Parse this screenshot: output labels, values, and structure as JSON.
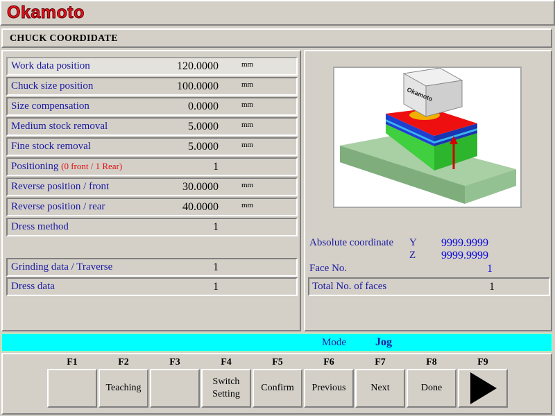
{
  "brand": "Okamoto",
  "screen_title": "CHUCK COORDIDATE",
  "params": [
    {
      "label": "Work data position",
      "value": "120.0000",
      "unit": "mm"
    },
    {
      "label": "Chuck size position",
      "value": "100.0000",
      "unit": "mm"
    },
    {
      "label": "Size compensation",
      "value": "0.0000",
      "unit": "mm"
    },
    {
      "label": "Medium stock removal",
      "value": "5.0000",
      "unit": "mm"
    },
    {
      "label": "Fine stock removal",
      "value": "5.0000",
      "unit": "mm"
    },
    {
      "label": "Positioning",
      "note": "(0 front / 1 Rear)",
      "value": "1",
      "unit": ""
    },
    {
      "label": "Reverse position / front",
      "value": "30.0000",
      "unit": "mm"
    },
    {
      "label": "Reverse position / rear",
      "value": "40.0000",
      "unit": "mm"
    },
    {
      "label": "Dress method",
      "value": "1",
      "unit": ""
    }
  ],
  "extra_params": [
    {
      "label": "Grinding data / Traverse",
      "value": "1"
    },
    {
      "label": "Dress data",
      "value": "1"
    }
  ],
  "illustration": {
    "wheel_text": "Okamoto"
  },
  "status": {
    "abs_coord_label": "Absolute coordinate",
    "y_axis": "Y",
    "y_value": "9999.9999",
    "z_axis": "Z",
    "z_value": "9999.9999",
    "face_no_label": "Face No.",
    "face_no_value": "1",
    "total_faces_label": "Total No. of faces",
    "total_faces_value": "1"
  },
  "mode": {
    "label": "Mode",
    "value": "Jog"
  },
  "function_keys": [
    {
      "key": "F1",
      "label": ""
    },
    {
      "key": "F2",
      "label": "Teaching"
    },
    {
      "key": "F3",
      "label": ""
    },
    {
      "key": "F4",
      "label": "Switch\nSetting"
    },
    {
      "key": "F5",
      "label": "Confirm"
    },
    {
      "key": "F6",
      "label": "Previous"
    },
    {
      "key": "F7",
      "label": "Next"
    },
    {
      "key": "F8",
      "label": "Done"
    },
    {
      "key": "F9",
      "label": "",
      "icon": "play-arrow-icon"
    }
  ],
  "colors": {
    "brand_red": "#e8101c",
    "label_blue": "#1a1aa0",
    "value_blue": "#0000e0",
    "mode_bar": "#00ffff",
    "note_red": "#e01010"
  }
}
